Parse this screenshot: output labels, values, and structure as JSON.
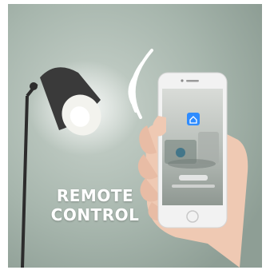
{
  "headline": {
    "line1": "REMOTE",
    "line2": "CONTROL"
  },
  "scene": {
    "background_color": "#a9b8ae",
    "lamp_color": "#3a3a3a",
    "phone_color": "#f2f2f2",
    "app_icon_color": "#2f8cff",
    "icons": [
      "lamp",
      "wifi-signal",
      "smartphone",
      "home-app-icon",
      "hand"
    ]
  }
}
